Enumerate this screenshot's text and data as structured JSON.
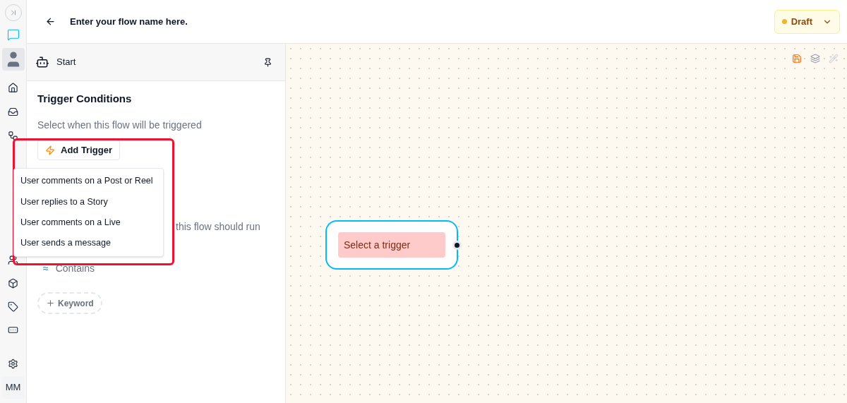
{
  "header": {
    "title": "Enter your flow name here.",
    "status": {
      "label": "Draft",
      "color": "#f0b429"
    }
  },
  "rail": {
    "user_initials": "MM"
  },
  "panel": {
    "node_title": "Start",
    "section_title": "Trigger Conditions",
    "subtitle": "Select when this flow will be triggered",
    "add_trigger_button": "Add Trigger",
    "partial_text": "this flow should run",
    "match_options": [
      {
        "symbol": "≈",
        "label": "Contains"
      }
    ],
    "keyword_button": "Keyword"
  },
  "trigger_menu": {
    "items": [
      {
        "label": "User comments on a Post or Reel"
      },
      {
        "label": "User replies to a Story"
      },
      {
        "label": "User comments on a Live"
      },
      {
        "label": "User sends a message"
      }
    ]
  },
  "canvas": {
    "node": {
      "label": "Select a trigger"
    }
  }
}
